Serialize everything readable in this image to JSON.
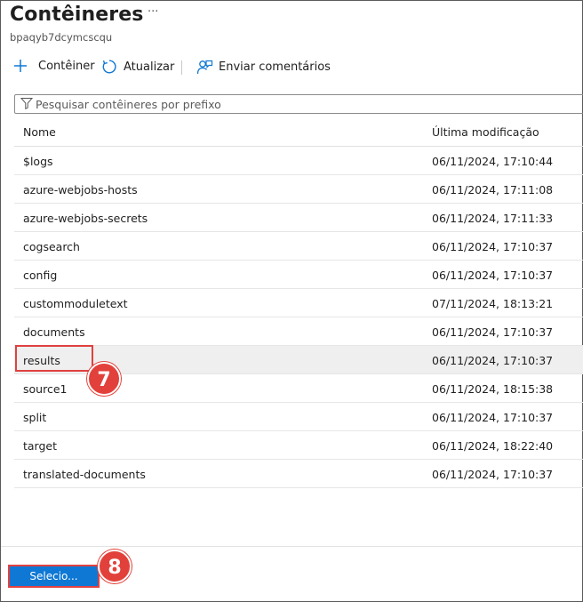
{
  "header": {
    "title": "Contêineres",
    "more_label": "···",
    "subtitle": "bpaqyb7dcymcscqu"
  },
  "toolbar": {
    "add_label": "Contêiner",
    "refresh_label": "Atualizar",
    "feedback_label": "Enviar comentários"
  },
  "search": {
    "placeholder": "Pesquisar contêineres por prefixo"
  },
  "table": {
    "columns": [
      "Nome",
      "Última modificação"
    ],
    "rows": [
      {
        "name": "$logs",
        "modified": "06/11/2024, 17:10:44"
      },
      {
        "name": "azure-webjobs-hosts",
        "modified": "06/11/2024, 17:11:08"
      },
      {
        "name": "azure-webjobs-secrets",
        "modified": "06/11/2024, 17:11:33"
      },
      {
        "name": "cogsearch",
        "modified": "06/11/2024, 17:10:37"
      },
      {
        "name": "config",
        "modified": "06/11/2024, 17:10:37"
      },
      {
        "name": "custommoduletext",
        "modified": "07/11/2024, 18:13:21"
      },
      {
        "name": "documents",
        "modified": "06/11/2024, 17:10:37"
      },
      {
        "name": "results",
        "modified": "06/11/2024, 17:10:37"
      },
      {
        "name": "source1",
        "modified": "06/11/2024, 18:15:38"
      },
      {
        "name": "split",
        "modified": "06/11/2024, 17:10:37"
      },
      {
        "name": "target",
        "modified": "06/11/2024, 18:22:40"
      },
      {
        "name": "translated-documents",
        "modified": "06/11/2024, 17:10:37"
      }
    ]
  },
  "footer": {
    "select_label": "Selecio..."
  },
  "annotations": {
    "step7": "7",
    "step8": "8",
    "highlight_color": "#e04141"
  },
  "colors": {
    "accent": "#0f78d4",
    "annotation": "#e2413b"
  }
}
